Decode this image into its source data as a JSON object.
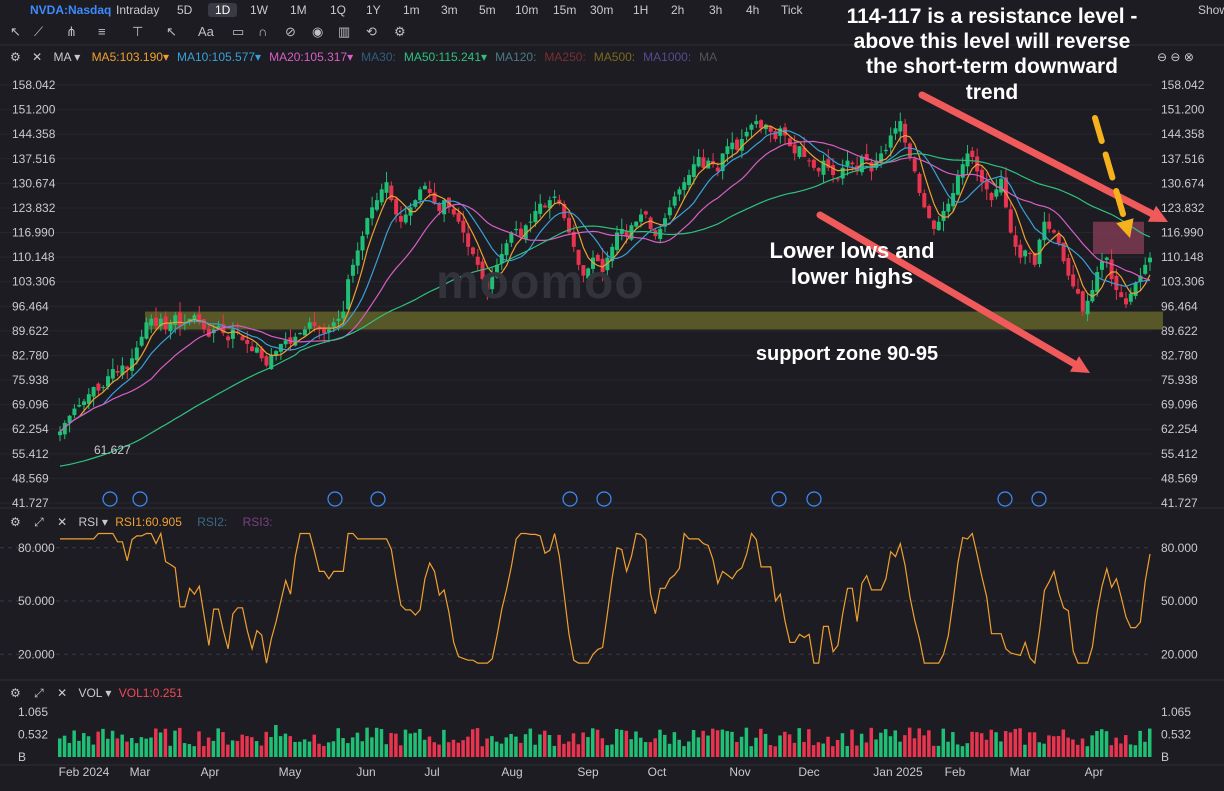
{
  "header": {
    "symbol": "NVDA:Nasdaq",
    "timeframes": [
      "Intraday",
      "5D",
      "1D",
      "1W",
      "1M",
      "1Q",
      "1Y",
      "1m",
      "3m",
      "5m",
      "10m",
      "15m",
      "30m",
      "1H",
      "2h",
      "3h",
      "4h",
      "Tick"
    ],
    "active_timeframe": "1D",
    "show_label": "Show"
  },
  "toolbar": {
    "icons": [
      "cursor-icon",
      "trendline-icon",
      "pitchfork-icon",
      "fib-icon",
      "ruler-icon",
      "arrow-icon",
      "text-icon",
      "comment-icon",
      "magnet-icon",
      "lock-icon",
      "eye-icon",
      "trash-icon",
      "sync-icon",
      "settings-icon"
    ],
    "text_tool_label": "Aa"
  },
  "price_legend": {
    "indicator": "MA",
    "items": [
      {
        "label": "MA5:103.190",
        "color": "#f0a030"
      },
      {
        "label": "MA10:105.577",
        "color": "#3aa0d8"
      },
      {
        "label": "MA20:105.317",
        "color": "#d65fc4"
      },
      {
        "label": "MA30:",
        "color": "#2f5e80"
      },
      {
        "label": "MA50:115.241",
        "color": "#2ec27e"
      },
      {
        "label": "MA120:",
        "color": "#4a7a86"
      },
      {
        "label": "MA250:",
        "color": "#7a3030"
      },
      {
        "label": "MA500:",
        "color": "#7a6a20"
      },
      {
        "label": "MA1000:",
        "color": "#5a4a90"
      },
      {
        "label": "MA",
        "color": "#555"
      }
    ]
  },
  "rsi_legend": {
    "label": "RSI",
    "rsi1": "RSI1:60.905",
    "rsi2": "RSI2:",
    "rsi3": "RSI3:"
  },
  "vol_legend": {
    "label": "VOL",
    "vol1": "VOL1:0.251"
  },
  "annotations": {
    "resistance": "114-117 is a resistance level - above this level will reverse the short-term downward trend",
    "lower": "Lower lows and lower highs",
    "support": "support zone 90-95"
  },
  "watermark": "moomoo",
  "low_marker": "61.627",
  "vol_unit": "B",
  "chart_data": [
    {
      "type": "candlestick",
      "title": "NVDA:Nasdaq 1D",
      "y_ticks": [
        "158.042",
        "151.200",
        "144.358",
        "137.516",
        "130.674",
        "123.832",
        "116.990",
        "110.148",
        "103.306",
        "96.464",
        "89.622",
        "82.780",
        "75.938",
        "69.096",
        "62.254",
        "55.412",
        "48.569",
        "41.727"
      ],
      "ylim": [
        41.727,
        158.042
      ],
      "x_ticks": [
        "Feb 2024",
        "Mar",
        "Apr",
        "May",
        "Jun",
        "Jul",
        "Aug",
        "Sep",
        "Oct",
        "Nov",
        "Dec",
        "Jan 2025",
        "Feb",
        "Mar",
        "Apr"
      ],
      "close_approx": [
        61.6,
        64,
        66,
        68,
        69,
        70,
        72,
        74,
        73,
        74,
        77,
        79,
        78,
        80,
        79,
        82,
        85,
        88,
        92,
        93,
        91,
        93,
        90,
        92,
        94,
        91,
        92,
        93,
        94,
        92,
        90,
        88,
        90,
        91,
        89,
        87,
        90,
        89,
        87,
        86,
        84,
        85,
        82,
        80,
        83,
        84,
        86,
        87,
        86,
        88,
        89,
        90,
        92,
        91,
        90,
        89,
        90,
        92,
        93,
        95,
        104,
        108,
        112,
        116,
        121,
        124,
        126,
        129,
        131,
        126,
        122,
        120,
        122,
        124,
        126,
        129,
        130,
        128,
        125,
        123,
        126,
        124,
        122,
        120,
        117,
        113,
        111,
        108,
        104,
        101,
        105,
        108,
        111,
        114,
        117,
        118,
        116,
        119,
        120,
        123,
        125,
        124,
        126,
        127,
        125,
        121,
        117,
        113,
        108,
        105,
        107,
        110,
        109,
        106,
        110,
        113,
        117,
        118,
        116,
        119,
        120,
        122,
        122,
        118,
        116,
        118,
        121,
        124,
        127,
        129,
        131,
        133,
        136,
        138,
        135,
        137,
        136,
        134,
        139,
        141,
        142,
        140,
        143,
        145,
        147,
        148,
        146,
        147,
        145,
        143,
        146,
        144,
        141,
        139,
        141,
        138,
        137,
        135,
        134,
        137,
        135,
        133,
        132,
        135,
        137,
        136,
        134,
        138,
        137,
        134,
        137,
        139,
        140,
        144,
        146,
        148,
        142,
        138,
        134,
        128,
        124,
        121,
        118,
        120,
        123,
        125,
        128,
        133,
        136,
        139,
        138,
        134,
        131,
        129,
        126,
        129,
        132,
        124,
        117,
        113,
        110,
        112,
        111,
        108,
        115,
        120,
        118,
        117,
        114,
        109,
        105,
        102,
        100,
        95,
        98,
        101,
        106,
        109,
        110,
        104,
        101,
        99,
        97,
        100,
        103,
        105,
        108,
        110
      ],
      "annotations_lines": [
        {
          "type": "zone",
          "label": "support zone 90-95",
          "range": [
            90,
            95
          ]
        },
        {
          "type": "zone",
          "label": "resistance 114-117",
          "range": [
            114,
            117
          ]
        }
      ],
      "series": [
        {
          "name": "MA5",
          "last": 103.19
        },
        {
          "name": "MA10",
          "last": 105.577
        },
        {
          "name": "MA20",
          "last": 105.317
        },
        {
          "name": "MA50",
          "last": 115.241
        }
      ]
    },
    {
      "type": "line",
      "title": "RSI",
      "series": [
        {
          "name": "RSI1",
          "last": 60.905
        }
      ],
      "y_ticks": [
        "80.000",
        "50.000",
        "20.000"
      ],
      "ylim": [
        10,
        90
      ]
    },
    {
      "type": "bar",
      "title": "VOL",
      "series": [
        {
          "name": "VOL1",
          "last": 0.251
        }
      ],
      "y_ticks": [
        "1.065",
        "0.532",
        "B"
      ],
      "ylim": [
        0,
        1.065
      ]
    }
  ]
}
